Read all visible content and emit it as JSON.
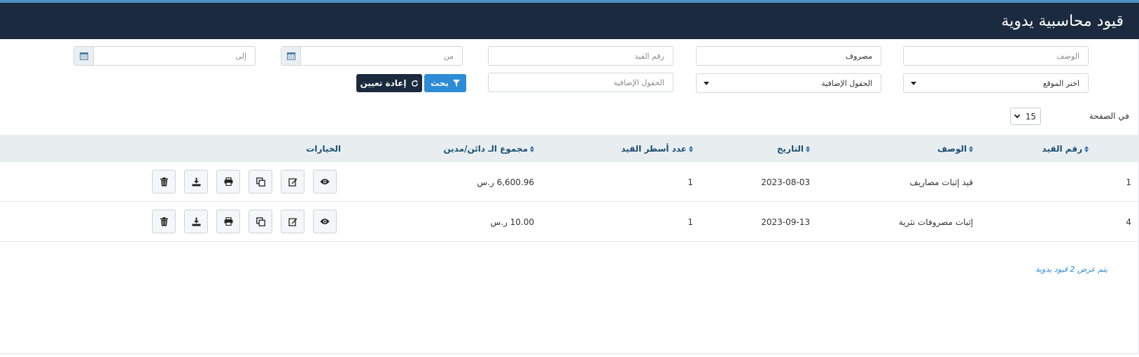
{
  "header": {
    "title": "قيود محاسبية يدوية"
  },
  "filters": {
    "description": {
      "placeholder": "الوصف",
      "value": ""
    },
    "type": {
      "value": "مصروف"
    },
    "entry_number": {
      "placeholder": "رقم القيد",
      "value": ""
    },
    "from_date": {
      "placeholder": "من",
      "value": ""
    },
    "to_date": {
      "placeholder": "إلى",
      "value": ""
    },
    "location": {
      "selected": "اختر الموقع"
    },
    "extra_fields_select": {
      "selected": "الحقول الإضافية"
    },
    "extra_fields_input": {
      "placeholder": "الحقول الإضافية",
      "value": ""
    },
    "search_label": "بحث",
    "reset_label": "إعادة تعيين"
  },
  "pagination": {
    "per_page_label": "في الصفحة",
    "per_page_value": "15"
  },
  "table": {
    "columns": [
      "رقم القيد",
      "الوصف",
      "التاريخ",
      "عدد أسطر القيد",
      "مجموع الـ دائن/مدين",
      "الخيارات"
    ],
    "rows": [
      {
        "number": "1",
        "description": "قيد إثبات مصاريف",
        "date": "2023-08-03",
        "lines": "1",
        "total": "6,600.96 ر.س"
      },
      {
        "number": "4",
        "description": "إثبات مصروفات نثرية",
        "date": "2023-09-13",
        "lines": "1",
        "total": "10.00 ر.س"
      }
    ],
    "actions": [
      "eye-icon",
      "edit-icon",
      "copy-icon",
      "print-icon",
      "download-icon",
      "trash-icon"
    ]
  },
  "footer": {
    "info": "يتم عرض 2 قيود يدوية"
  },
  "colors": {
    "header_bg": "#1b2a3e",
    "accent": "#2e8bd6",
    "table_head_bg": "#e8eef0"
  }
}
